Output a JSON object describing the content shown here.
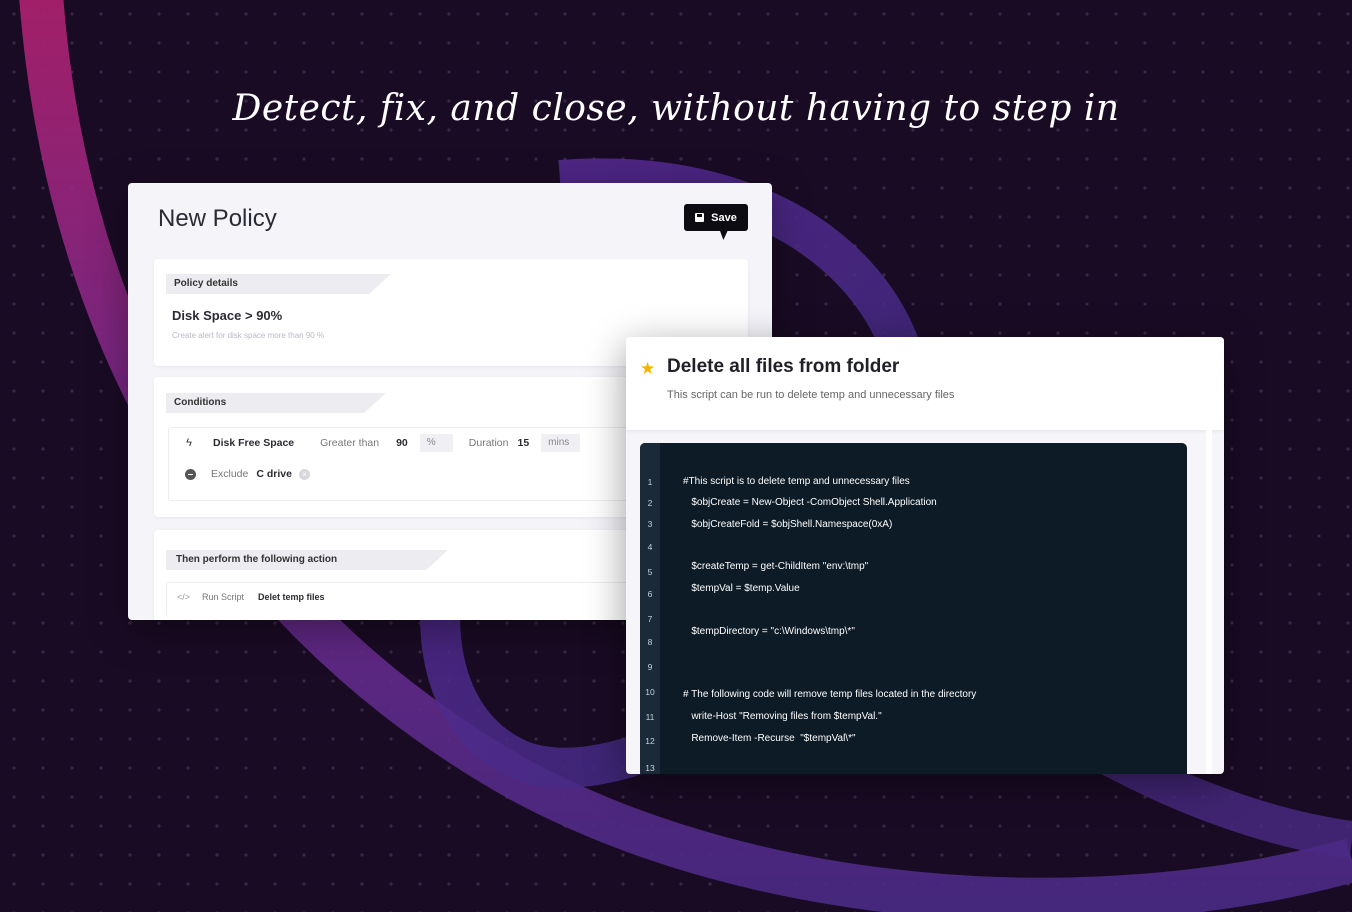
{
  "headline": "Detect, fix, and close, without having to step in",
  "policy": {
    "title": "New Policy",
    "save_label": "Save",
    "details_header": "Policy details",
    "name": "Disk Space > 90%",
    "description": "Create alert for disk space more than 90 %",
    "conditions_header": "Conditions",
    "condition": {
      "metric": "Disk Free Space",
      "operator": "Greater than",
      "value": "90",
      "unit": "%",
      "duration_label": "Duration",
      "duration_value": "15",
      "duration_unit": "mins"
    },
    "exclude": {
      "label": "Exclude",
      "value": "C drive"
    },
    "action_header": "Then perform the following action",
    "action": {
      "type": "Run Script",
      "name": "Delet temp files"
    }
  },
  "script": {
    "title": "Delete all files from folder",
    "description": "This script can be run to delete temp and unnecessary files",
    "line_numbers": [
      "1",
      "2",
      "3",
      "4",
      "5",
      "6",
      "7",
      "8",
      "9",
      "10",
      "11",
      "12",
      "13"
    ],
    "lines": [
      "#This script is to delete temp and unnecessary files",
      "   $objCreate = New-Object -ComObject Shell.Application",
      "   $objCreateFold = $objShell.Namespace(0xA)",
      "",
      "   $createTemp = get-ChildItem \"env:\\tmp\"",
      "   $tempVal = $temp.Value",
      "",
      "   $tempDirectory = \"c:\\Windows\\tmp\\*\"",
      "",
      "# The following code will remove temp files located in the directory",
      "   write-Host \"Removing files from $tempVal.\"",
      "   Remove-Item -Recurse  \"$tempVal\\*\"",
      ""
    ]
  },
  "colors": {
    "background": "#1a0b24",
    "accent_magenta": "#c2267e",
    "accent_purple": "#6a3bb0",
    "code_bg": "#0d1b26",
    "star": "#f5b400"
  }
}
